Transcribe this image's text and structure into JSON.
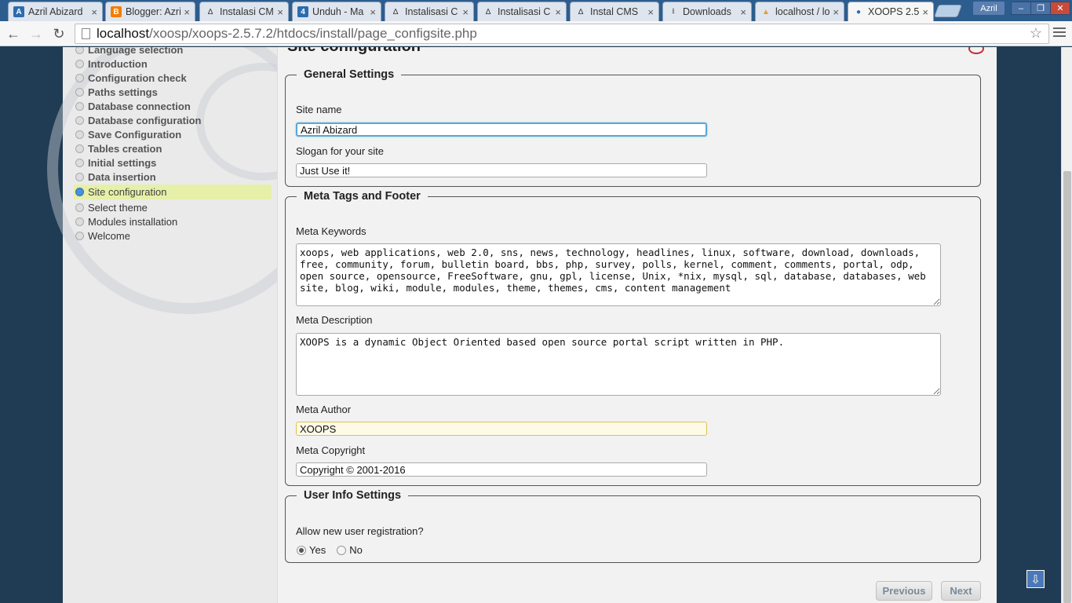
{
  "browser": {
    "tabs": [
      {
        "title": "Azril Abizard",
        "favicon": "A",
        "color": "#2b6cb0"
      },
      {
        "title": "Blogger: Azril",
        "favicon": "B",
        "color": "#f57c00"
      },
      {
        "title": "Instalasi CMS",
        "favicon": "tux",
        "color": "#333"
      },
      {
        "title": "Unduh - Ma",
        "favicon": "4",
        "color": "#2b6cb0"
      },
      {
        "title": "Instalisasi C",
        "favicon": "tux",
        "color": "#333"
      },
      {
        "title": "Instalisasi C",
        "favicon": "tux",
        "color": "#333"
      },
      {
        "title": "Instal CMS",
        "favicon": "tux",
        "color": "#333"
      },
      {
        "title": "Downloads",
        "favicon": "download",
        "color": "#555"
      },
      {
        "title": "localhost / lo",
        "favicon": "PMA",
        "color": "#e0a030"
      },
      {
        "title": "XOOPS 2.5",
        "favicon": "globe",
        "color": "#2b6cb0"
      }
    ],
    "user": "Azril",
    "url_host": "localhost",
    "url_path": "/xoosp/xoops-2.5.7.2/htdocs/install/page_configsite.php"
  },
  "sidebar": {
    "steps": [
      {
        "label": "Language selection",
        "state": "done"
      },
      {
        "label": "Introduction",
        "state": "done"
      },
      {
        "label": "Configuration check",
        "state": "done"
      },
      {
        "label": "Paths settings",
        "state": "done"
      },
      {
        "label": "Database connection",
        "state": "done"
      },
      {
        "label": "Database configuration",
        "state": "done"
      },
      {
        "label": "Save Configuration",
        "state": "done"
      },
      {
        "label": "Tables creation",
        "state": "done"
      },
      {
        "label": "Initial settings",
        "state": "done"
      },
      {
        "label": "Data insertion",
        "state": "done"
      },
      {
        "label": "Site configuration",
        "state": "current"
      },
      {
        "label": "Select theme",
        "state": "todo"
      },
      {
        "label": "Modules installation",
        "state": "todo"
      },
      {
        "label": "Welcome",
        "state": "todo"
      }
    ]
  },
  "main": {
    "title": "Site configuration",
    "general": {
      "legend": "General Settings",
      "site_name_label": "Site name",
      "site_name_value": "Azril Abizard",
      "slogan_label": "Slogan for your site",
      "slogan_value": "Just Use it!"
    },
    "meta": {
      "legend": "Meta Tags and Footer",
      "keywords_label": "Meta Keywords",
      "keywords_value": "xoops, web applications, web 2.0, sns, news, technology, headlines, linux, software, download, downloads, free, community, forum, bulletin board, bbs, php, survey, polls, kernel, comment, comments, portal, odp, open source, opensource, FreeSoftware, gnu, gpl, license, Unix, *nix, mysql, sql, database, databases, web site, blog, wiki, module, modules, theme, themes, cms, content management",
      "description_label": "Meta Description",
      "description_value": "XOOPS is a dynamic Object Oriented based open source portal script written in PHP.",
      "author_label": "Meta Author",
      "author_value": "XOOPS",
      "copyright_label": "Meta Copyright",
      "copyright_value": "Copyright © 2001-2016"
    },
    "user": {
      "legend": "User Info Settings",
      "question": "Allow new user registration?",
      "yes_label": "Yes",
      "no_label": "No",
      "selected": "Yes"
    },
    "previous_label": "Previous",
    "next_label": "Next"
  }
}
